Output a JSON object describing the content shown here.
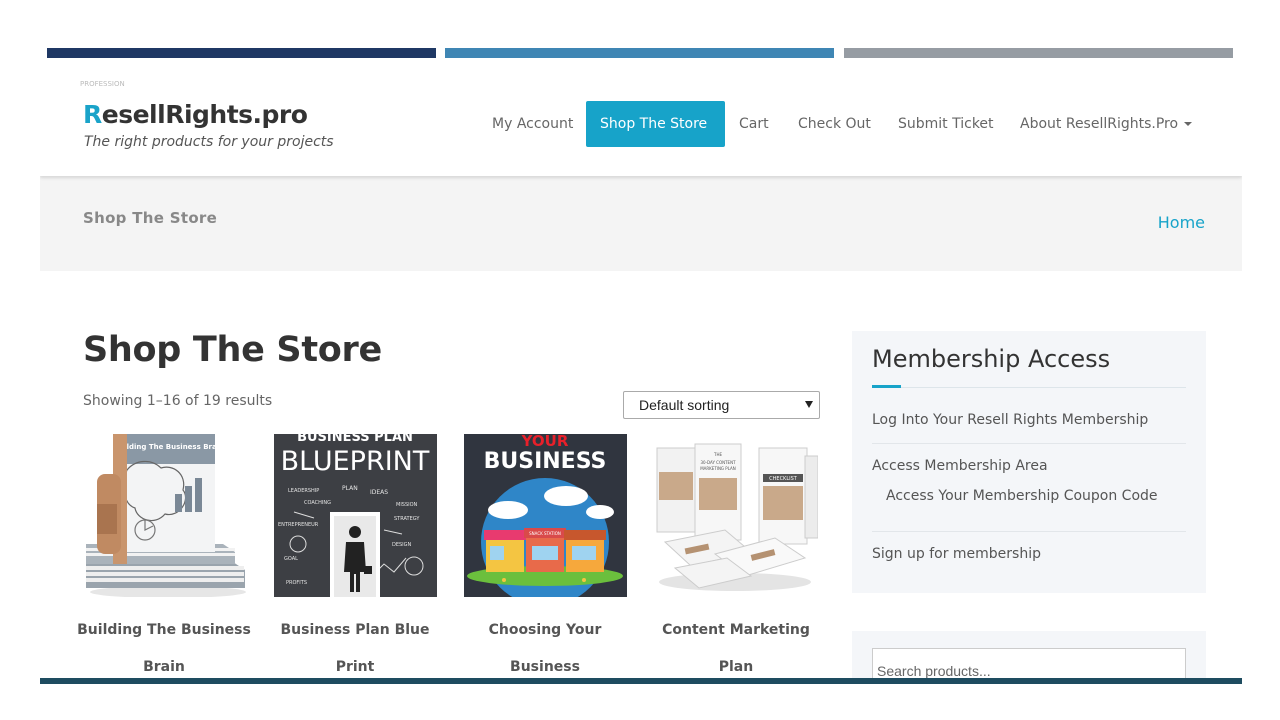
{
  "site": {
    "tiny_text": "PROFESSION",
    "logo_first": "R",
    "logo_rest": "esellRights.pro",
    "tagline": "The right products for your projects"
  },
  "nav": {
    "my_account": "My Account",
    "shop": "Shop The Store",
    "cart": "Cart",
    "checkout": "Check Out",
    "ticket": "Submit Ticket",
    "about": "About ResellRights.Pro"
  },
  "page_header": {
    "title": "Shop The Store",
    "breadcrumb_home": "Home"
  },
  "main": {
    "heading": "Shop The Store",
    "results": "Showing 1–16 of 19 results",
    "sorting": "Default sorting"
  },
  "products": [
    {
      "line1": "Building The Business",
      "line2": "Brain",
      "book_title": "Building The Business Brain"
    },
    {
      "line1": "Business Plan Blue",
      "line2": "Print",
      "img_top": "BUSINESS PLAN",
      "img_big": "BLUEPRINT",
      "doodles": [
        "LEADERSHIP",
        "PLAN",
        "IDEAS",
        "COACHING",
        "MISSION",
        "STRATEGY",
        "ENTREPRENEUR",
        "DESIGN",
        "GOAL",
        "PROFITS"
      ]
    },
    {
      "line1": "Choosing Your",
      "line2": "Business",
      "img_top": "YOUR",
      "img_big": "BUSINESS",
      "sign": "SNACK STATION"
    },
    {
      "line1": "Content Marketing",
      "line2": "Plan",
      "cover_small": "THE",
      "cover_line": "30-DAY CONTENT",
      "cover_line2": "MARKETING PLAN",
      "cover_tag": "CHECKLIST"
    }
  ],
  "sidebar": {
    "title": "Membership Access",
    "link1": "Log Into Your Resell Rights Membership",
    "link2": "Access Membership Area",
    "link3": "Access Your Membership Coupon Code",
    "link4": "Sign up for membership"
  },
  "search": {
    "placeholder": "Search products..."
  },
  "colors": {
    "accent": "#17a3c9",
    "bar_dark": "#1f3864",
    "bar_mid": "#3f86b4",
    "bar_gray": "#969ca3",
    "bottom_bar": "#1e4c60"
  }
}
